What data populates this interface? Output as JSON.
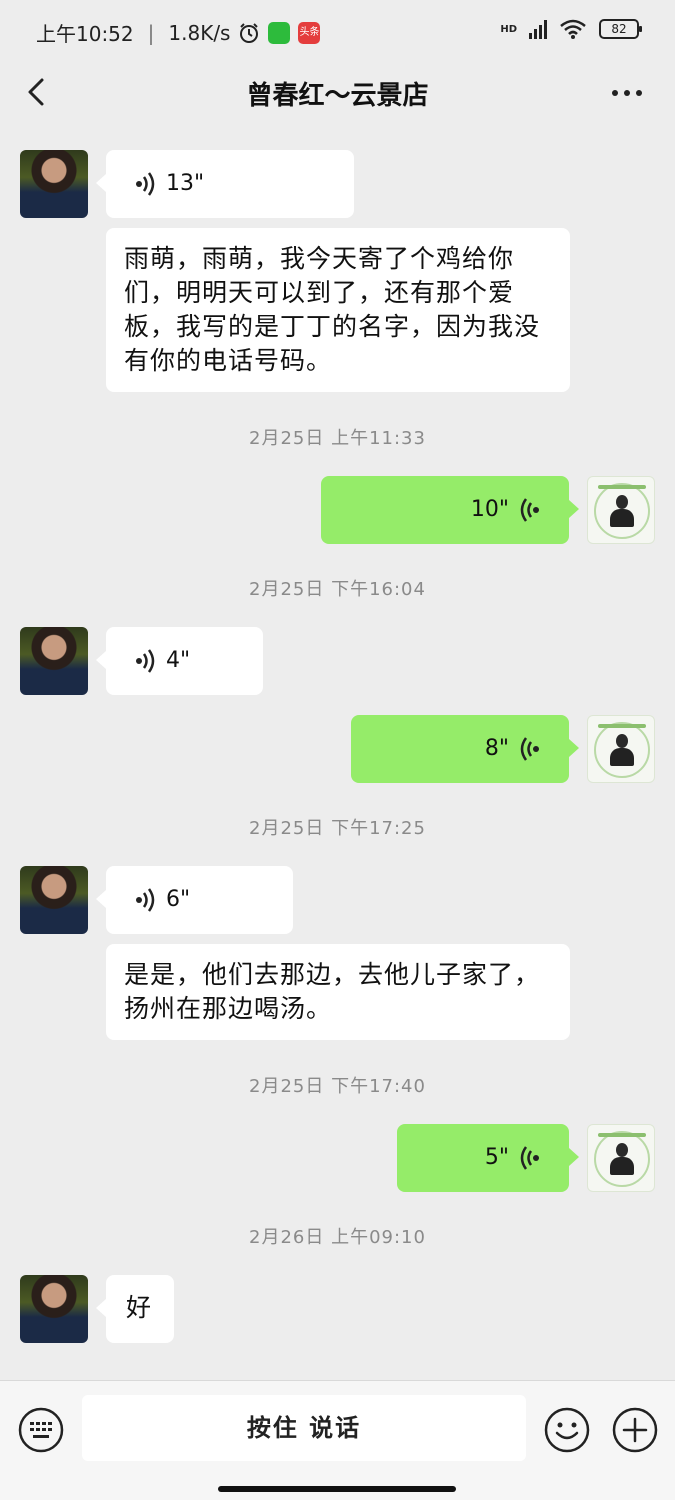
{
  "status_bar": {
    "time": "上午10:52",
    "separator": "|",
    "net_speed": "1.8K/s",
    "toutiao_label": "头条",
    "network_label": "HD",
    "battery": "82"
  },
  "nav": {
    "title": "曾春红～云景店",
    "back_icon": "chevron-left-icon",
    "more_icon": "ellipsis-icon"
  },
  "messages": [
    {
      "type": "voice",
      "dir": "in",
      "duration": "13\""
    },
    {
      "type": "text",
      "dir": "in",
      "text": "雨萌，雨萌，我今天寄了个鸡给你们，明明天可以到了，还有那个爱板，我写的是丁丁的名字，因为我没有你的电话号码。"
    },
    {
      "type": "time",
      "text": "2月25日 上午11:33"
    },
    {
      "type": "voice",
      "dir": "out",
      "duration": "10\""
    },
    {
      "type": "time",
      "text": "2月25日 下午16:04"
    },
    {
      "type": "voice",
      "dir": "in",
      "duration": "4\""
    },
    {
      "type": "voice",
      "dir": "out",
      "duration": "8\""
    },
    {
      "type": "time",
      "text": "2月25日 下午17:25"
    },
    {
      "type": "voice",
      "dir": "in",
      "duration": "6\""
    },
    {
      "type": "text",
      "dir": "in",
      "text": "是是，他们去那边，去他儿子家了，扬州在那边喝汤。"
    },
    {
      "type": "time",
      "text": "2月25日 下午17:40"
    },
    {
      "type": "voice",
      "dir": "out",
      "duration": "5\""
    },
    {
      "type": "time",
      "text": "2月26日 上午09:10"
    },
    {
      "type": "text",
      "dir": "in",
      "text": "好"
    }
  ],
  "input_bar": {
    "hold_to_talk": "按住 说话",
    "keyboard_icon": "keyboard-icon",
    "emoji_icon": "emoji-icon",
    "plus_icon": "plus-icon"
  },
  "colors": {
    "background": "#ededed",
    "bubble_in": "#ffffff",
    "bubble_out": "#95ec69",
    "timestamp": "#8a8a8a"
  }
}
